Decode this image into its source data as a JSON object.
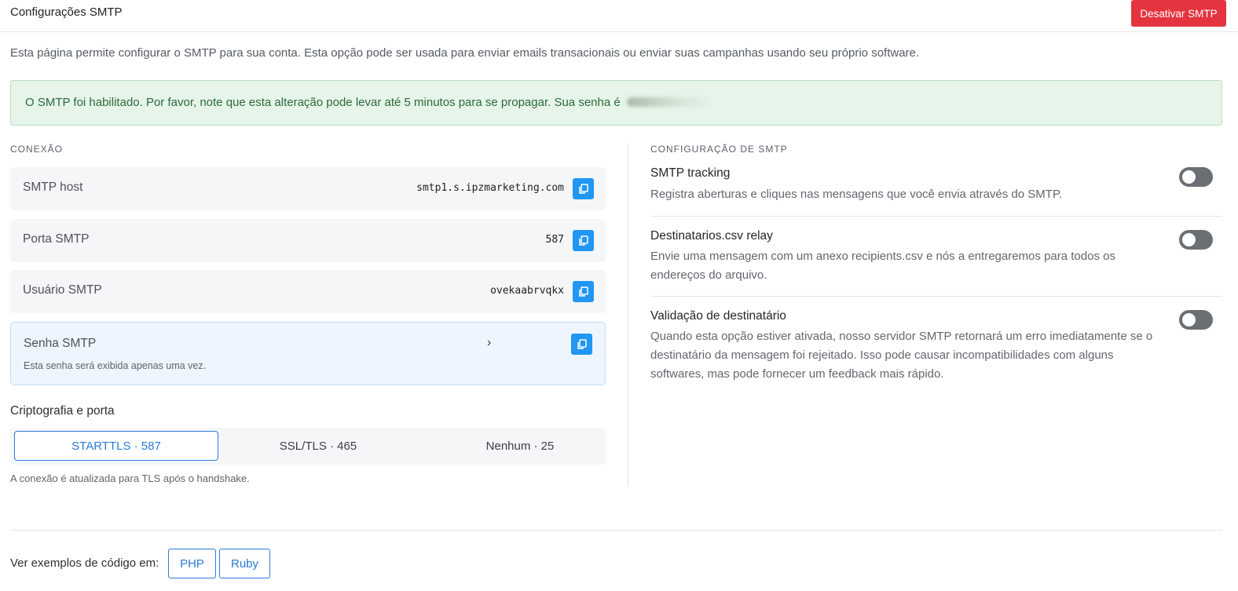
{
  "header": {
    "title": "Configurações SMTP",
    "disable_button": "Desativar SMTP"
  },
  "intro": "Esta página permite configurar o SMTP para sua conta. Esta opção pode ser usada para enviar emails transacionais ou enviar suas campanhas usando seu próprio software.",
  "alert": {
    "text": "O SMTP foi habilitado. Por favor, note que esta alteração pode levar até 5 minutos para se propagar. Sua senha é ",
    "password_partial": "›"
  },
  "connection": {
    "section_label": "CONEXÃO",
    "fields": [
      {
        "label": "SMTP host",
        "value": "smtp1.s.ipzmarketing.com"
      },
      {
        "label": "Porta SMTP",
        "value": "587"
      },
      {
        "label": "Usuário SMTP",
        "value": "ovekaabrvqkx"
      }
    ],
    "password": {
      "label": "Senha SMTP",
      "value": "›",
      "hint": "Esta senha será exibida apenas uma vez."
    },
    "copy_icon": "copy-icon"
  },
  "crypto": {
    "title": "Criptografia e porta",
    "options": [
      "STARTTLS · 587",
      "SSL/TLS · 465",
      "Nenhum · 25"
    ],
    "selected": "STARTTLS · 587",
    "note": "A conexão é atualizada para TLS após o handshake."
  },
  "smtp_config": {
    "section_label": "CONFIGURAÇÃO DE SMTP",
    "options": [
      {
        "title": "SMTP tracking",
        "description": "Registra aberturas e cliques nas mensagens que você envia através do SMTP.",
        "enabled": false
      },
      {
        "title": "Destinatarios.csv relay",
        "description": "Envie uma mensagem com um anexo recipients.csv e nós a entregaremos para todos os endereços do arquivo.",
        "enabled": false
      },
      {
        "title": "Validação de destinatário",
        "description": "Quando esta opção estiver ativada, nosso servidor SMTP retornará um erro imediatamente se o destinatário da mensagem foi rejeitado. Isso pode causar incompatibilidades com alguns softwares, mas pode fornecer um feedback mais rápido.",
        "enabled": false
      }
    ]
  },
  "examples": {
    "label": "Ver exemplos de código em:",
    "buttons": [
      "PHP",
      "Ruby"
    ]
  },
  "colors": {
    "danger": "#e3343f",
    "primary": "#2196f3",
    "link": "#2a7bd9",
    "success_bg": "#e6f4e9"
  }
}
